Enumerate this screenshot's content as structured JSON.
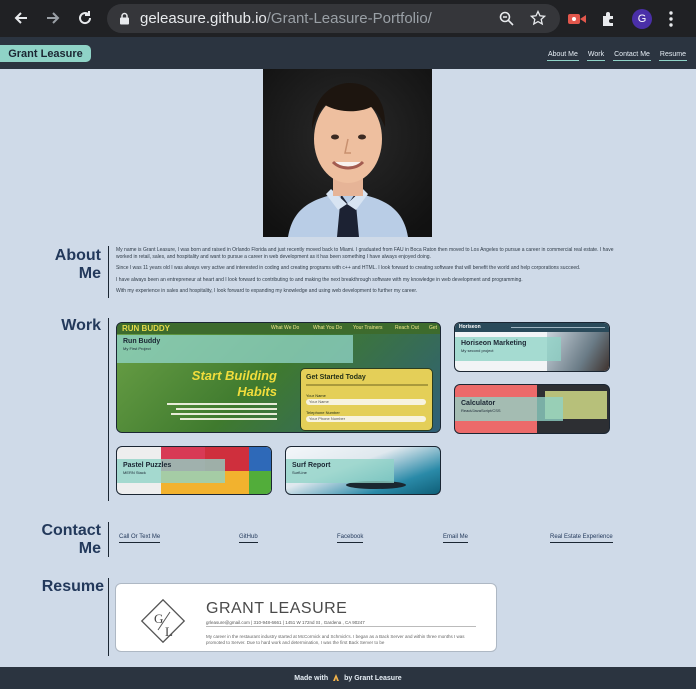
{
  "browser": {
    "domain": "geleasure.github.io",
    "path": "/Grant-Leasure-Portfolio/",
    "avatar_letter": "G"
  },
  "nav": {
    "brand": "Grant Leasure",
    "links": [
      "About Me",
      "Work",
      "Contact Me",
      "Resume"
    ]
  },
  "about": {
    "title": "About Me",
    "paragraphs": [
      "My name is Grant Leasure, I was born and raised in Orlando Florida and just recently moved back to Miami. I graduated from FAU in Boca Raton then moved to Los Angeles to pursue a career in commercial real estate. I have worked in retail, sales, and hospitality and want to pursue a career in web development as it has been something I have always enjoyed doing.",
      "Since I was 11 years old I was always very active and interested in coding and creating programs with c++ and HTML. I look forward to creating software that will benefit the world and help corporations succeed.",
      "I have always been an entrepreneur at heart and I look forward to contributing to and making the next breakthrough software with my knowledge in web development and programming.",
      "With my experience in sales and hospitality, I look forward to expanding my knowledge and using web development to further my career."
    ]
  },
  "work": {
    "title": "Work",
    "projects": [
      {
        "title": "Run Buddy",
        "subtitle": "My First Project"
      },
      {
        "title": "Horiseon Marketing",
        "subtitle": "My second project"
      },
      {
        "title": "Calculator",
        "subtitle": "React/JavaScript/CSS"
      },
      {
        "title": "Pastel Puzzles",
        "subtitle": "MERN Stack"
      },
      {
        "title": "Surf Report",
        "subtitle": "SurfLine"
      }
    ],
    "runbuddy": {
      "logo": "RUN BUDDY",
      "menu": [
        "What We Do",
        "What You Do",
        "Your Trainers",
        "Reach Out",
        "Get"
      ],
      "headline1": "Start Building",
      "headline2": "Habits",
      "form_title": "Get Started Today",
      "form_label1": "Your Name",
      "form_label2": "Telephone Number",
      "form_value1": "Your Name",
      "form_value2": "Your Phone Number"
    },
    "horiseon_logo": "Horiseon"
  },
  "contact": {
    "title": "Contact Me",
    "links": [
      "Call Or Text Me",
      "GitHub",
      "Facebook",
      "Email Me",
      "Real Estate Experience"
    ]
  },
  "resume": {
    "title": "Resume",
    "name": "GRANT LEASURE",
    "contact_line": "grleasure@gmail.com   |   310-948-6661   |   1451 W 172nd St , Gardena , CA 90247",
    "summary": "My career in the restaurant industry started at McCormick and Schmick's. I began as a Back Server and within three months I was promoted to Server. Due to hard work and determination, I was the first Back Server to be"
  },
  "footer": {
    "prefix": "Made with",
    "suffix": "by Grant Leasure"
  },
  "colors": {
    "background": "#cfdae8",
    "nav": "#2b3440",
    "accent": "#8fd3c7",
    "heading": "#23395b"
  }
}
